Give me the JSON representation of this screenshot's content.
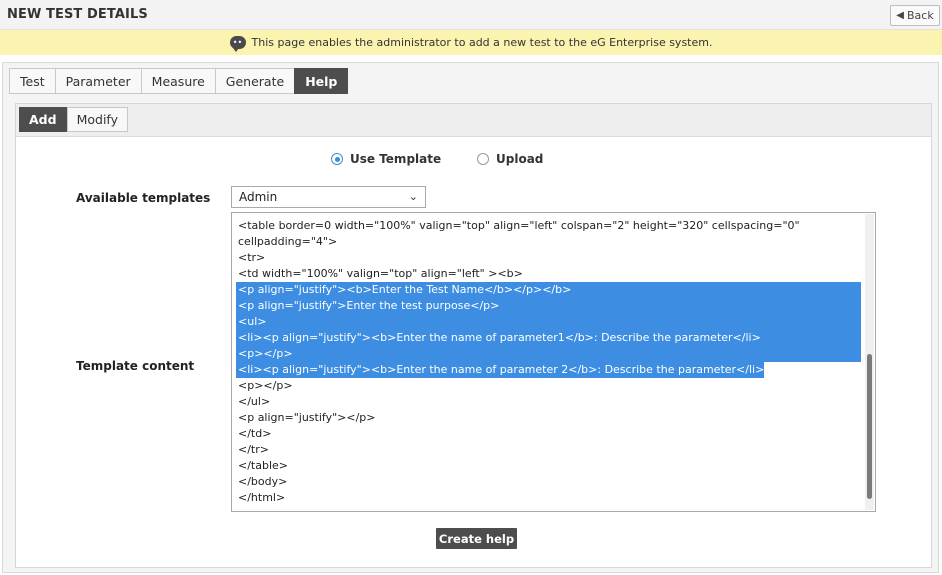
{
  "header": {
    "title": "NEW TEST DETAILS",
    "back_label": "Back",
    "back_icon": "arrow-left-icon"
  },
  "notice": {
    "icon": "speech-bubble-icon",
    "text": "This page enables the administrator to add a new test to the eG Enterprise system."
  },
  "tabs": [
    {
      "label": "Test",
      "active": false
    },
    {
      "label": "Parameter",
      "active": false
    },
    {
      "label": "Measure",
      "active": false
    },
    {
      "label": "Generate",
      "active": false
    },
    {
      "label": "Help",
      "active": true
    }
  ],
  "subtabs": [
    {
      "label": "Add",
      "active": true
    },
    {
      "label": "Modify",
      "active": false
    }
  ],
  "mode": {
    "options": [
      {
        "label": "Use Template",
        "checked": true
      },
      {
        "label": "Upload",
        "checked": false
      }
    ]
  },
  "form": {
    "available_templates_label": "Available templates",
    "template_selected": "Admin",
    "template_content_label": "Template content",
    "create_button_label": "Create help"
  },
  "template_content": {
    "lines": [
      "<table border=0 width=\"100%\" valign=\"top\" align=\"left\" colspan=\"2\" height=\"320\" cellspacing=\"0\"",
      "cellpadding=\"4\">",
      "<tr>",
      "<td width=\"100%\" valign=\"top\" align=\"left\" ><b>",
      "<p align=\"justify\"><b>Enter the Test Name</b></p></b>",
      "<p align=\"justify\">Enter the test purpose</p>",
      "<ul>",
      "<li><p align=\"justify\"><b>Enter the name of parameter1</b>: Describe the parameter</li>",
      "<p></p>",
      "<li><p align=\"justify\"><b>Enter the name of parameter 2</b>: Describe the parameter</li>",
      "<p></p>",
      "</ul>",
      "<p align=\"justify\"></p>",
      "</td>",
      "</tr>",
      "</table>",
      "</body>",
      "</html>"
    ],
    "selection_color": "#3d8ee2"
  },
  "colors": {
    "active_tab": "#4d4d4d",
    "notice_bg": "#fbf3b0",
    "radio_checked": "#3a8fd1"
  }
}
